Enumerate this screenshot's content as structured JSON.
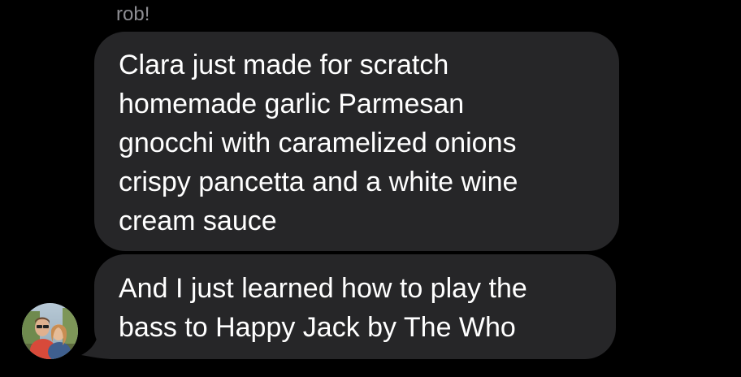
{
  "conversation": {
    "sender_name": "rob!",
    "messages": [
      {
        "text": "Clara just made for scratch\nhomemade garlic Parmesan\ngnocchi with caramelized onions\ncrispy pancetta and a white wine\ncream sauce"
      },
      {
        "text": "And I just learned how to play the\nbass to Happy Jack by The Who"
      }
    ]
  },
  "colors": {
    "background": "#000000",
    "bubble": "#262628",
    "sender_name": "#8e8e93",
    "message_text": "#ffffff"
  },
  "icons": {
    "avatar": "contact-avatar-photo"
  }
}
